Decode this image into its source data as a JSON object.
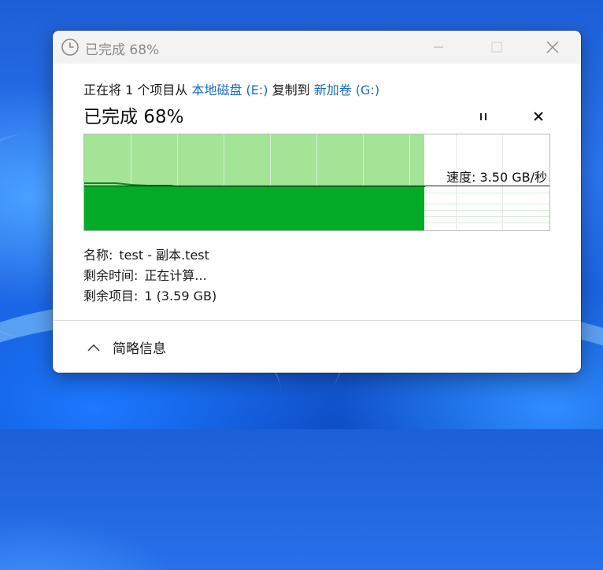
{
  "window": {
    "title": "已完成 68%"
  },
  "transfer": {
    "desc_prefix": "正在将 1 个项目从 ",
    "source": "本地磁盘 (E:)",
    "desc_middle": " 复制到 ",
    "destination": "新加卷 (G:)",
    "progress_label": "已完成 68%",
    "progress_percent": 68,
    "speed_label": "速度: 3.50 GB/秒"
  },
  "info": {
    "name_label": "名称:",
    "name_value": "test - 副本.test",
    "time_label": "剩余时间:",
    "time_value": "正在计算...",
    "items_label": "剩余项目:",
    "items_value": "1 (3.59 GB)"
  },
  "footer": {
    "toggle_label": "简略信息"
  },
  "colors": {
    "graph_light": "#a3e497",
    "graph_dark": "#04ab26",
    "link": "#1a6fbf"
  }
}
